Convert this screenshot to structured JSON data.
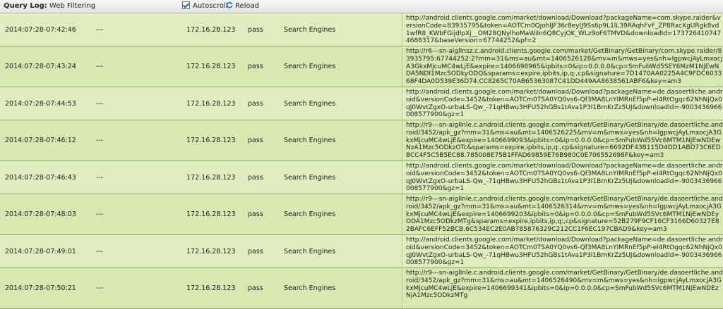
{
  "header": {
    "title_bold": "Query Log:",
    "title_rest": "Web Filtering",
    "autoscroll_label": "Autoscroll",
    "reload_label": "Reload"
  },
  "rows": [
    {
      "time": "2014:07:28-07:42:46",
      "user": "---",
      "ip": "172.16.28.123",
      "action": "pass",
      "category": "Search Engines",
      "url": "http://android.clients.google.com/market/download/Download?packageName=com.skype.raider&versionCode=83935795&token=AOTCm0QjohlJF36r8eyIJ9Ss6p9L1lL39RAqhFvF_ZP8RxcXgURgk8vd1wfR8_KWbFGijdIpXj__OM28QNylhoMaWiIn6Q8CyjOK_WLz9oF6TMVD&downloadId=1737264107474688317&baseVersion=67744252&pf=2"
    },
    {
      "time": "2014:07:28-07:43:24",
      "user": "---",
      "ip": "172.16.28.123",
      "action": "pass",
      "category": "Search Engines",
      "url": "http://r6---sn-aiglInsz.c.android.clients.google.com/market/GetBinary/GetBinary/com.skype.raider/83935795:67744252:2?mm=31&ms=au&mt=1406526128&mv=m&mws=yes&nh=IgpwcjAyLmxocjA3GkxMjcuMC4wLjE&expire=1406698965&ipbits=0&ip=0.0.0.0&cp=SmFubWd5SEY6MzM1NjEwNDA5NDI1MzcSODkyODQ&sparams=expire,ipbits,ip,q:,cp&signature=7D1470AA0225A4C9FDC603368F4DA0D539E36D74.CC8265C70AB65363087C41DD449AA8638561ABF6&key=am3"
    },
    {
      "time": "2014:07:28-07:44:53",
      "user": "---",
      "ip": "172.16.28.123",
      "action": "pass",
      "category": "Search Engines",
      "url": "http://android.clients.google.com/market/download/Download?packageName=de.dasoertliche.android&versionCode=3452&token=AOTCm0TSA0YQ0vs6-Qf3MA8LnYIMRnEf5pP-el4RtOgqc62NhNjQx0qJ0WvtZgxO-urbaLS-Qw_-71qHBwu3HFU52hGBs1tAva1P3I1BmKrZz5UJ&downloadId=-9003436966008577900&gz=1"
    },
    {
      "time": "2014:07:28-07:46:12",
      "user": "---",
      "ip": "172.16.28.123",
      "action": "pass",
      "category": "Search Engines",
      "url": "http://r9---sn-aiglInle.c.android.clients.google.com/market/GetBinary/GetBinary/de.dasoertliche.android/3452/apk_gz?mm=31&ms=au&mt=1406526225&mv=m&mws=yes&nh=IgpwcjAyLmxocjA3GkxMjcuMC4wLjE&expire=1406699093&ipbits=0&ip=0.0.0.0&cp=SmFubWd5SVc6MTM1NjEwNDEwNzA1Mzc5ODkzOTc&sparams=expire,ipbits,ip,q:,cp&signature=6692DF43B115D4DD1ABD73C6EDBCC4F5C5B5EC88.785008E75B1FFAD69859E76B980C0E706552698F&key=am3"
    },
    {
      "time": "2014:07:28-07:46:43",
      "user": "---",
      "ip": "172.16.28.123",
      "action": "pass",
      "category": "Search Engines",
      "url": "http://android.clients.google.com/market/download/Download?packageName=de.dasoertliche.android&versionCode=3452&token=AOTCm0TSA0YQ0vs6-Qf3MA8LnYIMRnEf5pP-el4RtOgqc62NhNjQx0qJ0WvtZgxO-urbaLS-Qw_-71qHBwu3HFU52hGBs1tAva1P3I1BmKrZz5UJ&downloadId=-9003436966008577900&gz=1"
    },
    {
      "time": "2014:07:28-07:48:03",
      "user": "---",
      "ip": "172.16.28.123",
      "action": "pass",
      "category": "Search Engines",
      "url": "http://r9---sn-aiglInle.c.android.clients.google.com/market/GetBinary/GetBinary/de.dasoertliche.android/3452/apk_gz?mm=31&ms=au&mt=1406526314&mv=m&mws=yes&nh=IgpwcjAyLmxocjA3GkxMjcuMC4wLjE&expire=1406699203&ipbits=0&ip=0.0.0.0&cp=SmFubWd5SVc6MTM1NjEwNDEyODA1Mzc5ODkzMTg&sparams=expire,ipbits,ip,q:,cp&signature=52B279F9CF16CF3166D60327E82BAFC6EFF52BCB.6C534EC2E0AB785876329C212CC1F6EC197CBAD9&key=am3"
    },
    {
      "time": "2014:07:28-07:49:01",
      "user": "---",
      "ip": "172.16.28.123",
      "action": "pass",
      "category": "Search Engines",
      "url": "http://android.clients.google.com/market/download/Download?packageName=de.dasoertliche.android&versionCode=3452&token=AOTCm0TSA0YQ0vs6-Qf3MA8LnYIMRnEf5pP-el4RtOgqc62NhNjQx0qJ0WvtZgxO-urbaLS-Qw_-71qHBwu3HFU52hGBs1tAva1P3I1BmKrZz5UJ&downloadId=-9003436966008577900&gz=1"
    },
    {
      "time": "2014:07:28-07:50:21",
      "user": "---",
      "ip": "172.16.28.123",
      "action": "pass",
      "category": "Search Engines",
      "url": "http://r9---sn-aiglInle.c.android.clients.google.com/market/GetBinary/GetBinary/de.dasoertliche.android/3452/apk_gz?mm=31&ms=au&mt=1406526490&mv=m&mws=yes&nh=IgpwcjAyLmxocjA3GkxMjcuMC4wLjE&expire=1406699341&ipbits=0&ip=0.0.0.0&cp=SmFubWd5SVc6MTM1NjEwNDEzNjA1Mzc5ODkzMTg"
    }
  ]
}
